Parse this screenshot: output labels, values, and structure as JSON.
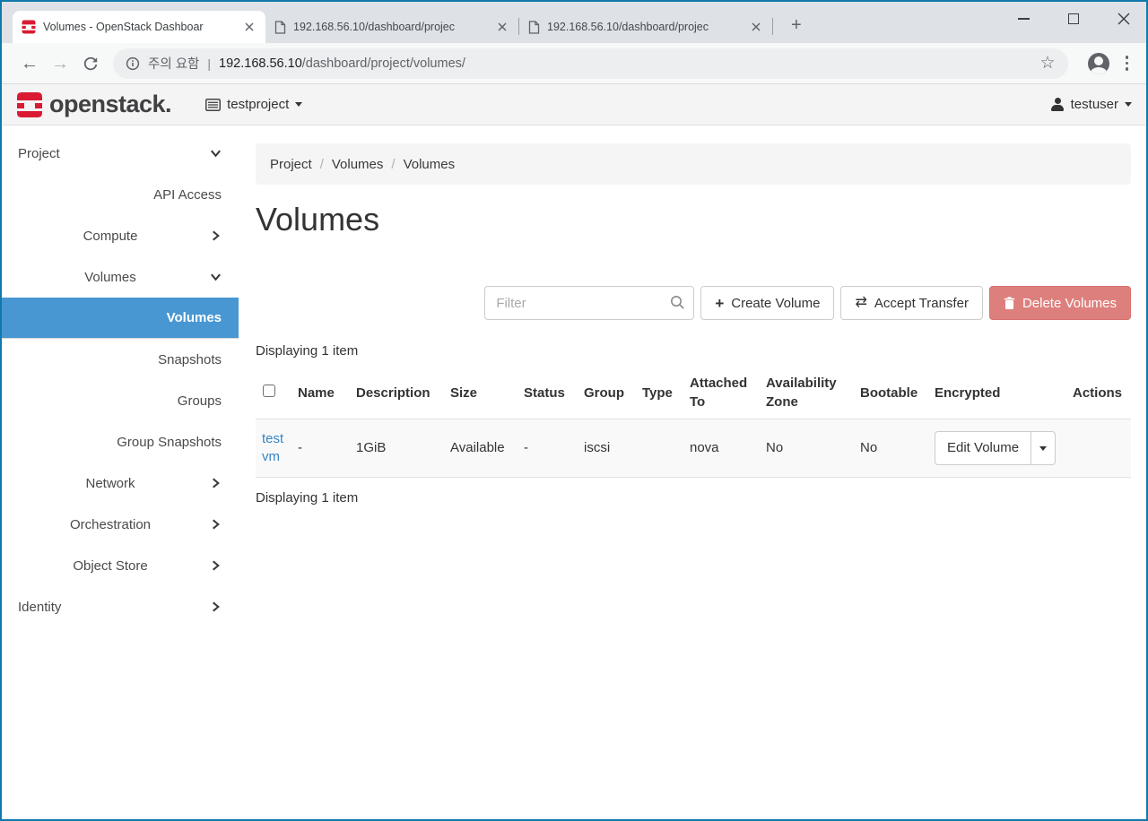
{
  "browser": {
    "tabs": [
      {
        "title": "Volumes - OpenStack Dashboar"
      },
      {
        "title": "192.168.56.10/dashboard/projec"
      },
      {
        "title": "192.168.56.10/dashboard/projec"
      }
    ],
    "new_tab_glyph": "+",
    "address": {
      "security_label": "주의 요함",
      "separator": "|",
      "host": "192.168.56.10",
      "path": "/dashboard/project/volumes/"
    },
    "glyphs": {
      "back": "←",
      "forward": "→",
      "star": "☆"
    }
  },
  "header": {
    "brand": "openstack.",
    "project": "testproject",
    "user": "testuser"
  },
  "sidebar": {
    "items": [
      {
        "label": "Project"
      },
      {
        "label": "API Access"
      },
      {
        "label": "Compute"
      },
      {
        "label": "Volumes"
      },
      {
        "label": "Volumes"
      },
      {
        "label": "Snapshots"
      },
      {
        "label": "Groups"
      },
      {
        "label": "Group Snapshots"
      },
      {
        "label": "Network"
      },
      {
        "label": "Orchestration"
      },
      {
        "label": "Object Store"
      },
      {
        "label": "Identity"
      }
    ]
  },
  "page": {
    "breadcrumb": [
      "Project",
      "Volumes",
      "Volumes"
    ],
    "breadcrumb_sep": "/",
    "title": "Volumes",
    "filter_placeholder": "Filter",
    "buttons": {
      "create": "Create Volume",
      "create_icon": "+",
      "transfer": "Accept Transfer",
      "transfer_icon": "⇄",
      "delete": "Delete Volumes"
    },
    "count_top": "Displaying 1 item",
    "count_bottom": "Displaying 1 item",
    "table": {
      "headers": [
        "Name",
        "Description",
        "Size",
        "Status",
        "Group",
        "Type",
        "Attached To",
        "Availability Zone",
        "Bootable",
        "Encrypted",
        "Actions"
      ],
      "row": {
        "name": "test vm",
        "cells": [
          "-",
          "1GiB",
          "Available",
          "-",
          "iscsi",
          "",
          "nova",
          "No",
          "No"
        ],
        "action": "Edit Volume"
      }
    }
  },
  "colors": {
    "sidebar_active": "#4897d2",
    "danger_button": "#dd807d",
    "brand_red": "#da1a32",
    "link": "#3585c5",
    "screenshot_border": "#1079ab"
  }
}
